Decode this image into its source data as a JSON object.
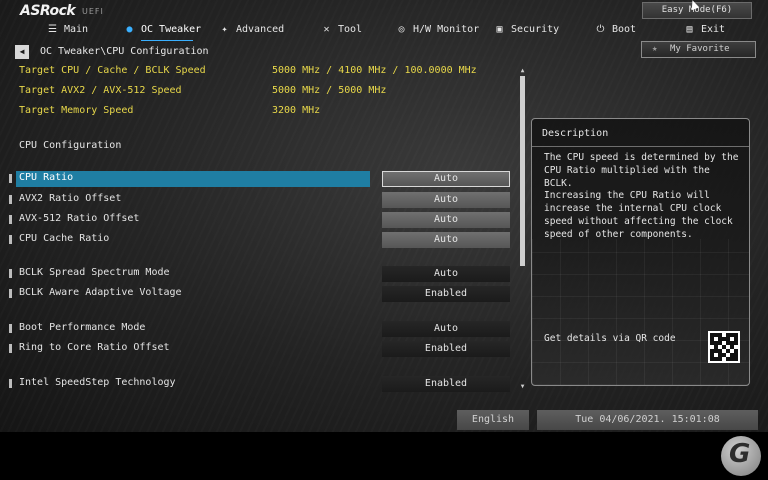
{
  "header": {
    "logo": "ASRock",
    "logo_sub": "UEFI",
    "easy_mode": "Easy Mode(F6)",
    "my_favorite": "My Favorite"
  },
  "tabs": [
    {
      "label": "Main",
      "icon": "list-icon",
      "active": false
    },
    {
      "label": "OC Tweaker",
      "icon": "flame-icon",
      "active": true
    },
    {
      "label": "Advanced",
      "icon": "star-icon",
      "active": false
    },
    {
      "label": "Tool",
      "icon": "wrench-icon",
      "active": false
    },
    {
      "label": "H/W Monitor",
      "icon": "monitor-icon",
      "active": false
    },
    {
      "label": "Security",
      "icon": "shield-icon",
      "active": false
    },
    {
      "label": "Boot",
      "icon": "power-icon",
      "active": false
    },
    {
      "label": "Exit",
      "icon": "exit-icon",
      "active": false
    }
  ],
  "breadcrumb": "OC Tweaker\\CPU Configuration",
  "targets": [
    {
      "label": "Target CPU / Cache / BCLK Speed",
      "value": "5000 MHz / 4100 MHz / 100.0000 MHz"
    },
    {
      "label": "Target AVX2 / AVX-512 Speed",
      "value": "5000 MHz / 5000 MHz"
    },
    {
      "label": "Target Memory Speed",
      "value": "3200 MHz"
    }
  ],
  "section_title": "CPU Configuration",
  "settings": [
    {
      "label": "CPU  Ratio",
      "value": "Auto",
      "style": "light",
      "selected": true
    },
    {
      "label": "AVX2 Ratio Offset",
      "value": "Auto",
      "style": "light",
      "selected": false
    },
    {
      "label": "AVX-512 Ratio Offset",
      "value": "Auto",
      "style": "light",
      "selected": false
    },
    {
      "label": "CPU  Cache Ratio",
      "value": "Auto",
      "style": "light",
      "selected": false
    },
    {
      "label": "BCLK Spread Spectrum Mode",
      "value": "Auto",
      "style": "dark",
      "selected": false
    },
    {
      "label": "BCLK Aware Adaptive Voltage",
      "value": "Enabled",
      "style": "dark",
      "selected": false
    },
    {
      "label": "Boot Performance Mode",
      "value": "Auto",
      "style": "dark",
      "selected": false
    },
    {
      "label": "Ring to Core Ratio Offset",
      "value": "Enabled",
      "style": "dark",
      "selected": false
    },
    {
      "label": "Intel SpeedStep Technology",
      "value": "Enabled",
      "style": "dark",
      "selected": false
    }
  ],
  "description": {
    "title": "Description",
    "text": "The CPU speed is determined by the\nCPU Ratio multiplied with the BCLK.\nIncreasing the CPU Ratio will\nincrease the internal CPU clock\nspeed without affecting the clock\nspeed of other components.",
    "qr_label": "Get details via QR code"
  },
  "status": {
    "language": "English",
    "datetime": "Tue 04/06/2021. 15:01:08"
  }
}
